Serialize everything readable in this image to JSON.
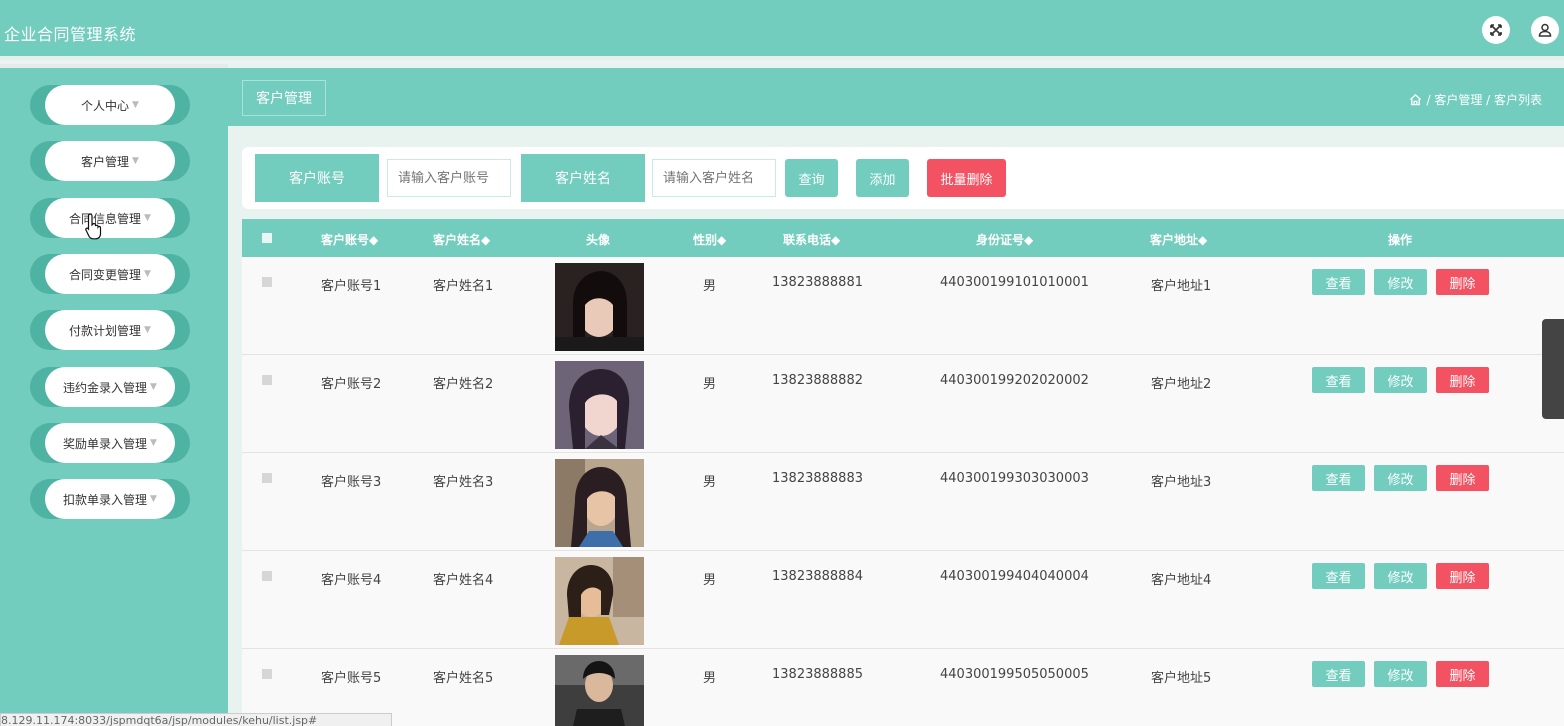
{
  "app": {
    "title": "企业合同管理系统"
  },
  "sidebar": {
    "items": [
      {
        "label": "个人中心"
      },
      {
        "label": "客户管理"
      },
      {
        "label": "合同信息管理"
      },
      {
        "label": "合同变更管理"
      },
      {
        "label": "付款计划管理"
      },
      {
        "label": "违约金录入管理"
      },
      {
        "label": "奖励单录入管理"
      },
      {
        "label": "扣款单录入管理"
      }
    ]
  },
  "header": {
    "page_title": "客户管理",
    "breadcrumb": "/ 客户管理 / 客户列表"
  },
  "search": {
    "account_label": "客户账号",
    "account_placeholder": "请输入客户账号",
    "name_label": "客户姓名",
    "name_placeholder": "请输入客户姓名",
    "query_button": "查询",
    "add_button": "添加",
    "batch_delete_button": "批量删除"
  },
  "table": {
    "columns": [
      "客户账号◆",
      "客户姓名◆",
      "头像",
      "性别◆",
      "联系电话◆",
      "身份证号◆",
      "客户地址◆",
      "操作"
    ],
    "actions": {
      "view": "查看",
      "edit": "修改",
      "delete": "删除"
    },
    "rows": [
      {
        "account": "客户账号1",
        "name": "客户姓名1",
        "gender": "男",
        "phone": "13823888881",
        "id_number": "440300199101010001",
        "address": "客户地址1"
      },
      {
        "account": "客户账号2",
        "name": "客户姓名2",
        "gender": "男",
        "phone": "13823888882",
        "id_number": "440300199202020002",
        "address": "客户地址2"
      },
      {
        "account": "客户账号3",
        "name": "客户姓名3",
        "gender": "男",
        "phone": "13823888883",
        "id_number": "440300199303030003",
        "address": "客户地址3"
      },
      {
        "account": "客户账号4",
        "name": "客户姓名4",
        "gender": "男",
        "phone": "13823888884",
        "id_number": "440300199404040004",
        "address": "客户地址4"
      },
      {
        "account": "客户账号5",
        "name": "客户姓名5",
        "gender": "男",
        "phone": "13823888885",
        "id_number": "440300199505050005",
        "address": "客户地址5"
      }
    ]
  },
  "status_bar": {
    "url": "8.129.11.174:8033/jspmdqt6a/jsp/modules/kehu/list.jsp#"
  },
  "colors": {
    "primary": "#72cdbf",
    "danger": "#f25262"
  },
  "icons": {
    "fullscreen": "fullscreen-icon",
    "user": "user-icon",
    "home": "home-icon"
  }
}
